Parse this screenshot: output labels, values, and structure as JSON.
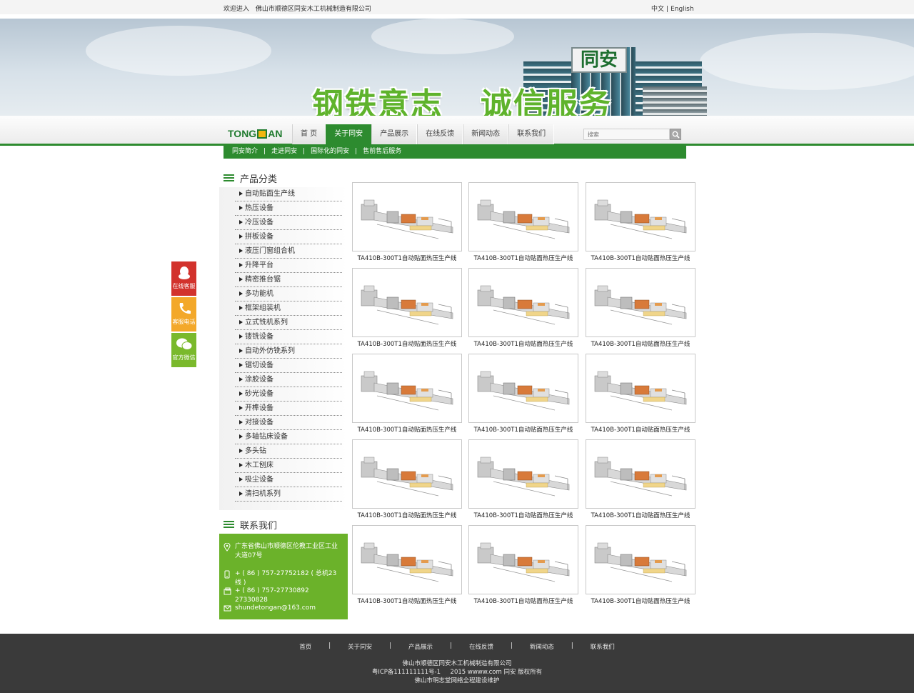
{
  "topbar": {
    "welcome_prefix": "欢迎进入",
    "company": "佛山市顺德区同安木工机械制造有限公司",
    "lang_cn": "中文",
    "lang_sep": "|",
    "lang_en": "English"
  },
  "banner": {
    "slogan": "钢铁意志   诚信服务",
    "building_sign": "同安"
  },
  "logo": {
    "text_left": "TONG",
    "text_right": "AN"
  },
  "nav": {
    "items": [
      {
        "label": "首 页",
        "active": false
      },
      {
        "label": "关于同安",
        "active": true
      },
      {
        "label": "产品展示",
        "active": false
      },
      {
        "label": "在线反馈",
        "active": false
      },
      {
        "label": "新闻动态",
        "active": false
      },
      {
        "label": "联系我们",
        "active": false
      }
    ]
  },
  "search": {
    "placeholder": "搜索"
  },
  "subnav": {
    "items": [
      "同安简介",
      "走进同安",
      "国际化的同安",
      "售前售后服务"
    ],
    "separator": "|"
  },
  "float_service": {
    "qq": "在线客服",
    "tel": "客服电话",
    "wechat": "官方微信"
  },
  "categories": {
    "title": "产品分类",
    "items": [
      "自动贴面生产线",
      "热压设备",
      "冷压设备",
      "拼板设备",
      "液压门窗组合机",
      "升降平台",
      "精密推台锯",
      "多功能机",
      "框架组装机",
      "立式铣机系列",
      "镂铣设备",
      "自动外仿铣系列",
      "锯切设备",
      "涂胶设备",
      "砂光设备",
      "开榫设备",
      "对接设备",
      "多轴钻床设备",
      "多头钻",
      "木工刨床",
      "吸尘设备",
      "清扫机系列"
    ]
  },
  "contact": {
    "title": "联系我们",
    "address": "广东省佛山市顺德区伦教工业区工业大道07号",
    "phone": "+ ( 86 ) 757-27752182 ( 总机23线 )",
    "fax": "+ ( 86 ) 757-27730892 27330828",
    "email": "shundetongan@163.com"
  },
  "products": {
    "items": [
      "TA410B-300T1自动贴面热压生产线",
      "TA410B-300T1自动贴面热压生产线",
      "TA410B-300T1自动贴面热压生产线",
      "TA410B-300T1自动贴面热压生产线",
      "TA410B-300T1自动贴面热压生产线",
      "TA410B-300T1自动贴面热压生产线",
      "TA410B-300T1自动贴面热压生产线",
      "TA410B-300T1自动贴面热压生产线",
      "TA410B-300T1自动贴面热压生产线",
      "TA410B-300T1自动贴面热压生产线",
      "TA410B-300T1自动贴面热压生产线",
      "TA410B-300T1自动贴面热压生产线",
      "TA410B-300T1自动贴面热压生产线",
      "TA410B-300T1自动贴面热压生产线",
      "TA410B-300T1自动贴面热压生产线"
    ]
  },
  "footer": {
    "links": [
      "首页",
      "关于同安",
      "产品展示",
      "在线反馈",
      "新闻动态",
      "联系我们"
    ],
    "separator": "|",
    "line1": "佛山市顺德区同安木工机械制造有限公司",
    "line2": "粤ICP备111111111号-1     2015 wwww.com 同安 版权所有",
    "line3": "佛山市明志堂网络全程建设维护"
  },
  "colors": {
    "brand_green": "#2d8b2f",
    "contact_green": "#6bb22a",
    "qq_red": "#d2322c",
    "tel_orange": "#f3a82a",
    "wechat_green": "#7ab92c",
    "footer_bg": "#3a3a3a"
  }
}
